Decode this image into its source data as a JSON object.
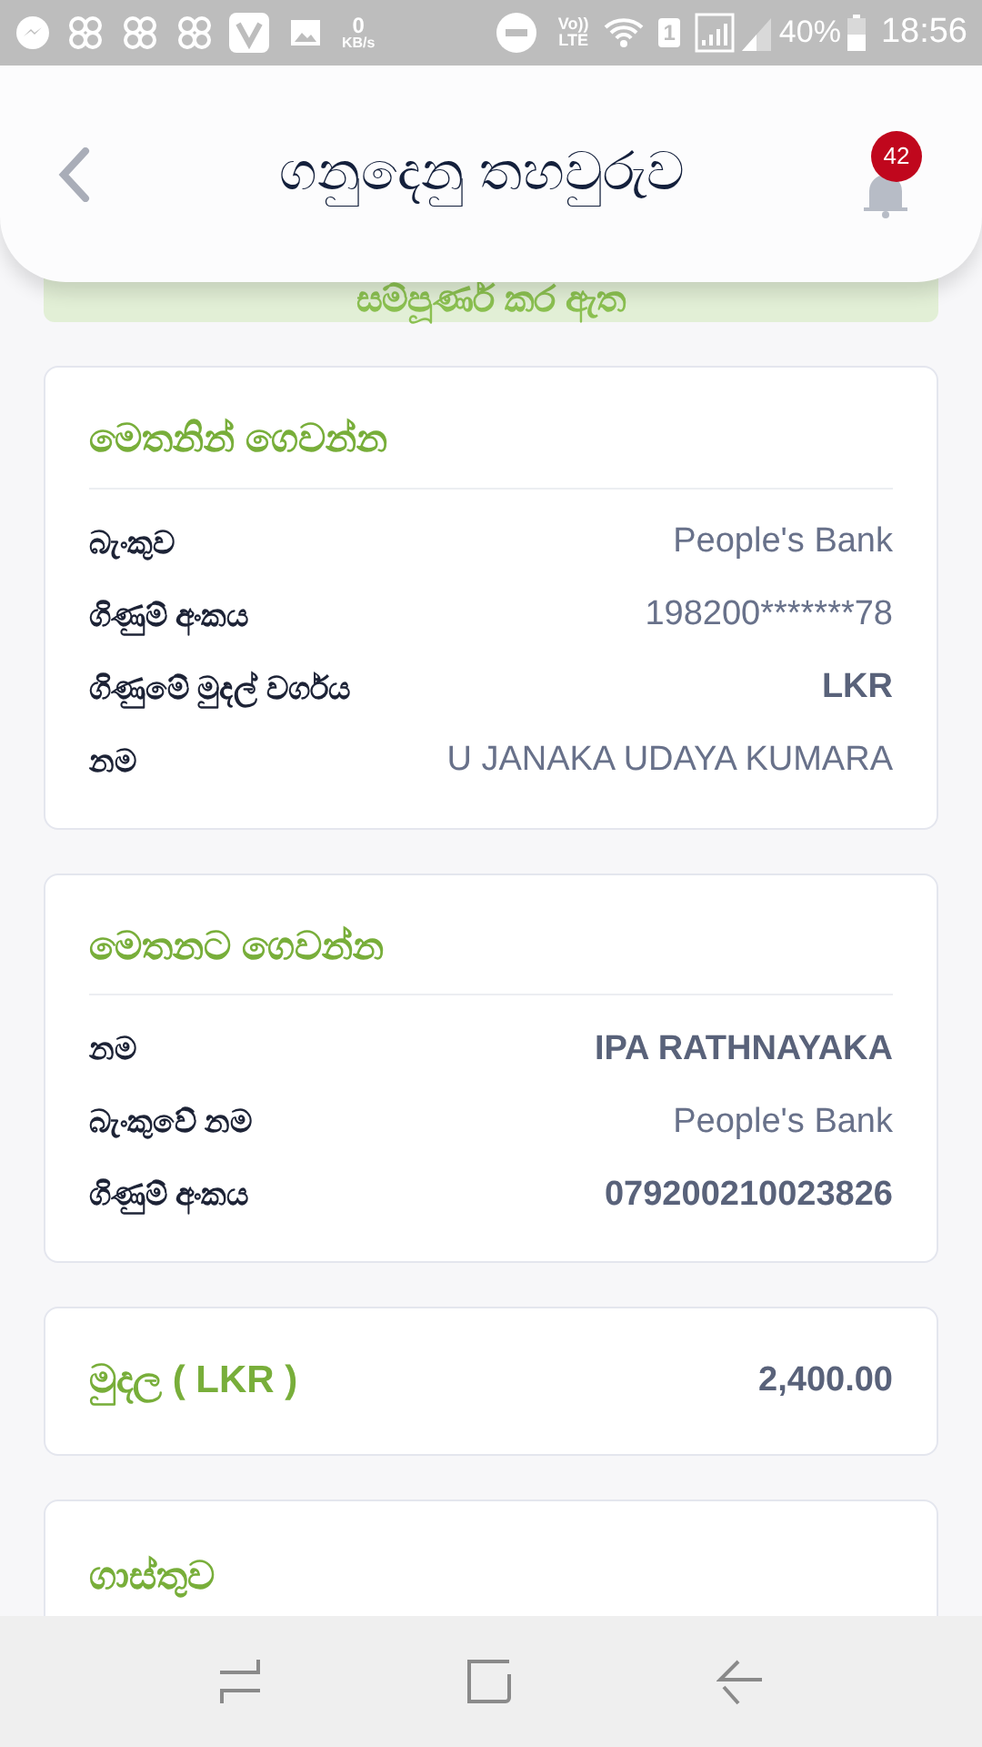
{
  "status_bar": {
    "speed_value": "0",
    "speed_unit": "KB/s",
    "volte": "Vo))",
    "lte": "LTE",
    "sim": "1",
    "battery": "40%",
    "time": "18:56"
  },
  "header": {
    "title": "ගනුදෙනු තහවුරුව",
    "badge": "42"
  },
  "banner": {
    "text": "සම්පූර්ණ කර ඇත"
  },
  "cards": [
    {
      "title": "මෙතනින් ගෙවන්න",
      "rows": [
        {
          "label": "බැංකුව",
          "value": "People's Bank",
          "bold": false
        },
        {
          "label": "ගිණුම් අංකය",
          "value": "198200*******78",
          "bold": false
        },
        {
          "label": "ගිණුමේ මුදල් වර්ගය",
          "value": "LKR",
          "bold": true
        },
        {
          "label": "නම",
          "value": "U JANAKA UDAYA KUMARA",
          "bold": false
        }
      ]
    },
    {
      "title": "මෙතනට ගෙවන්න",
      "rows": [
        {
          "label": "නම",
          "value": "IPA RATHNAYAKA",
          "bold": true
        },
        {
          "label": "බැංකුවේ නම",
          "value": "People's Bank",
          "bold": false
        },
        {
          "label": "ගිණුම් අංකය",
          "value": "079200210023826",
          "bold": true
        }
      ]
    }
  ],
  "amount": {
    "label": "මුදල ( LKR )",
    "value": "2,400.00"
  },
  "fee_card": {
    "title": "ගාස්තුව"
  }
}
